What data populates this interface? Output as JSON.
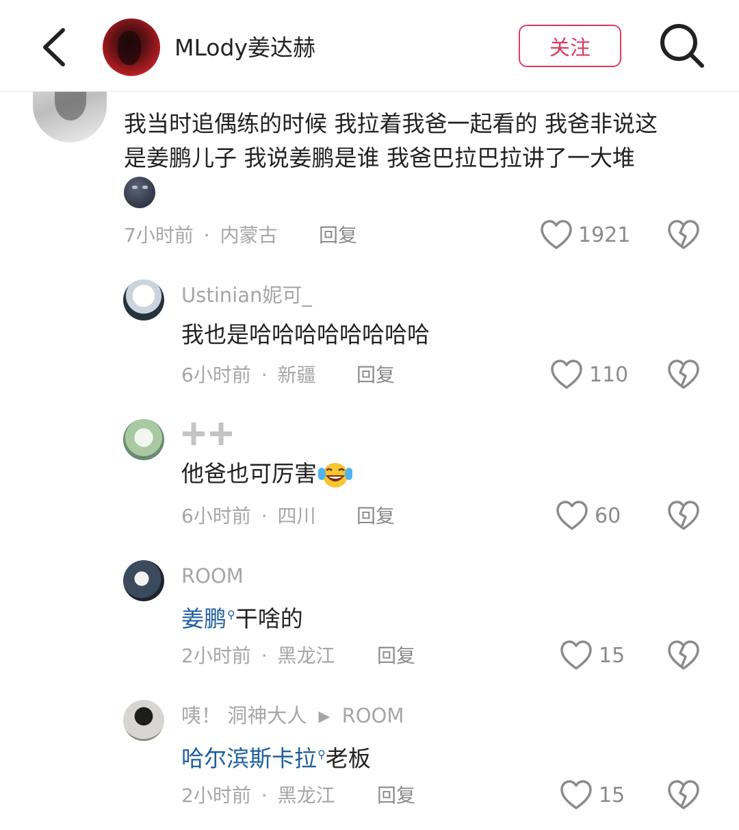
{
  "header": {
    "title": "MLody姜达赫",
    "follow_label": "关注",
    "back_icon": "chevron-left-icon",
    "search_icon": "search-icon"
  },
  "colors": {
    "accent": "#e0385f",
    "link": "#1f5f9d",
    "meta": "#a6a6a6"
  },
  "comments": [
    {
      "text_line1": "我当时追偶练的时候 我拉着我爸一起看的 我爸非说这",
      "text_line2": "是姜鹏儿子 我说姜鹏是谁 我爸巴拉巴拉讲了一大堆",
      "emoji": "new-moon-face-emoji",
      "time": "7小时前",
      "location": "内蒙古",
      "reply_label": "回复",
      "likes": "1921"
    }
  ],
  "replies": [
    {
      "username": "Ustinian妮可_",
      "text": "我也是哈哈哈哈哈哈哈哈",
      "time": "6小时前",
      "location": "新疆",
      "reply_label": "回复",
      "likes": "110"
    },
    {
      "username_icon": "plus-plus-icon",
      "text": "他爸也可厉害",
      "emoji": "laughing-tears-emoji",
      "time": "6小时前",
      "location": "四川",
      "reply_label": "回复",
      "likes": "60"
    },
    {
      "username": "ROOM",
      "link_text": "姜鹏",
      "text": "干啥的",
      "time": "2小时前",
      "location": "黑龙江",
      "reply_label": "回复",
      "likes": "15"
    },
    {
      "username": "咦！ 洞神大人",
      "reply_to": "ROOM",
      "link_text": "哈尔滨斯卡拉",
      "text": "老板",
      "time": "2小时前",
      "location": "黑龙江",
      "reply_label": "回复",
      "likes": "15"
    }
  ],
  "separator": "·"
}
